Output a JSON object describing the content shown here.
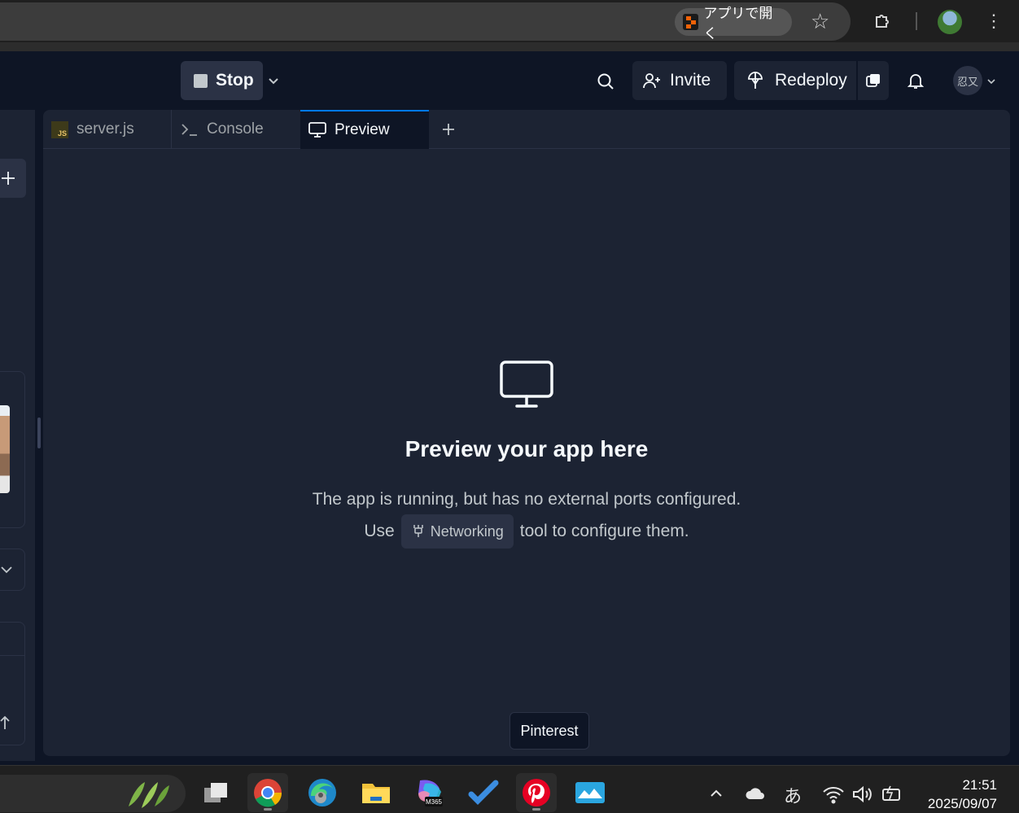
{
  "chrome": {
    "open_app_label": "アプリで開く",
    "icons": [
      "replit-logo-icon",
      "star-icon",
      "extensions-icon",
      "profile-avatar",
      "more-vert-icon"
    ]
  },
  "header": {
    "stop_label": "Stop",
    "invite_label": "Invite",
    "redeploy_label": "Redeploy",
    "user_initials": "忍又"
  },
  "tabs": [
    {
      "label": "server.js",
      "icon": "js-file-icon",
      "active": false
    },
    {
      "label": "Console",
      "icon": "terminal-icon",
      "active": false
    },
    {
      "label": "Preview",
      "icon": "monitor-icon",
      "active": true
    }
  ],
  "preview": {
    "title": "Preview your app here",
    "line1": "The app is running, but has no external ports configured.",
    "line2_prefix": "Use",
    "chip_label": "Networking",
    "line2_suffix": "tool to configure them."
  },
  "tooltip": "Pinterest",
  "taskbar": {
    "apps": [
      "task-view",
      "chrome",
      "edge",
      "file-explorer",
      "m365-copilot",
      "todo",
      "pinterest",
      "photos"
    ],
    "m365_badge": "M365",
    "ime_label": "あ",
    "time": "21:51",
    "date": "2025/09/07"
  },
  "colors": {
    "bg": "#0e1525",
    "panel": "#1c2333",
    "accent_blue": "#0079f2",
    "replit_orange": "#f26207",
    "pinterest_red": "#e60023"
  }
}
